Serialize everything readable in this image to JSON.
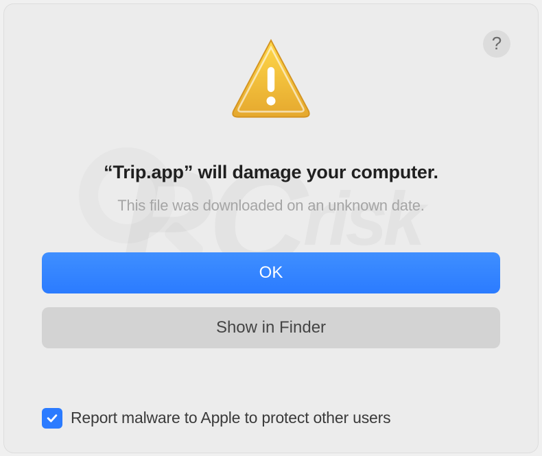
{
  "dialog": {
    "headline": "“Trip.app” will damage your computer.",
    "subtext": "This file was downloaded on an unknown date.",
    "primary_button": "OK",
    "secondary_button": "Show in Finder",
    "help_tooltip": "?",
    "checkbox_label": "Report malware to Apple to protect other users",
    "checkbox_checked": true
  },
  "icons": {
    "warning": "warning-triangle-icon",
    "help": "help-icon",
    "checkmark": "checkmark-icon"
  },
  "colors": {
    "primary": "#2b7bff",
    "secondary": "#d3d3d3",
    "background": "#ececec",
    "text_muted": "#a5a5a5"
  }
}
